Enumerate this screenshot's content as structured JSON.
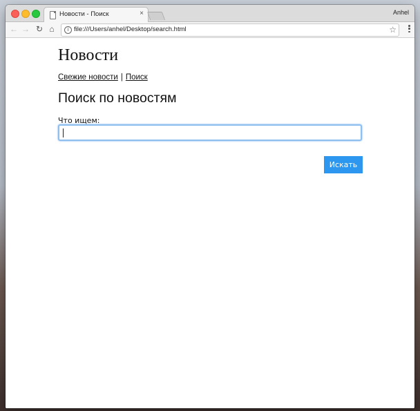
{
  "browser": {
    "tab_title": "Новости - Поиск",
    "tab_close": "×",
    "profile_name": "Anhel",
    "url": "file:///Users/anhel/Desktop/search.html",
    "nav_back": "←",
    "nav_forward": "→",
    "nav_reload": "↻",
    "nav_home": "⌂",
    "info_glyph": "i",
    "star_glyph": "☆"
  },
  "page": {
    "site_title": "Новости",
    "nav_links": [
      {
        "label": "Свежие новости"
      },
      {
        "label": "Поиск"
      }
    ],
    "nav_separator": "|",
    "section_title": "Поиск по новостям",
    "search": {
      "label": "Что ищем:",
      "value": ""
    },
    "submit_label": "Искать"
  }
}
